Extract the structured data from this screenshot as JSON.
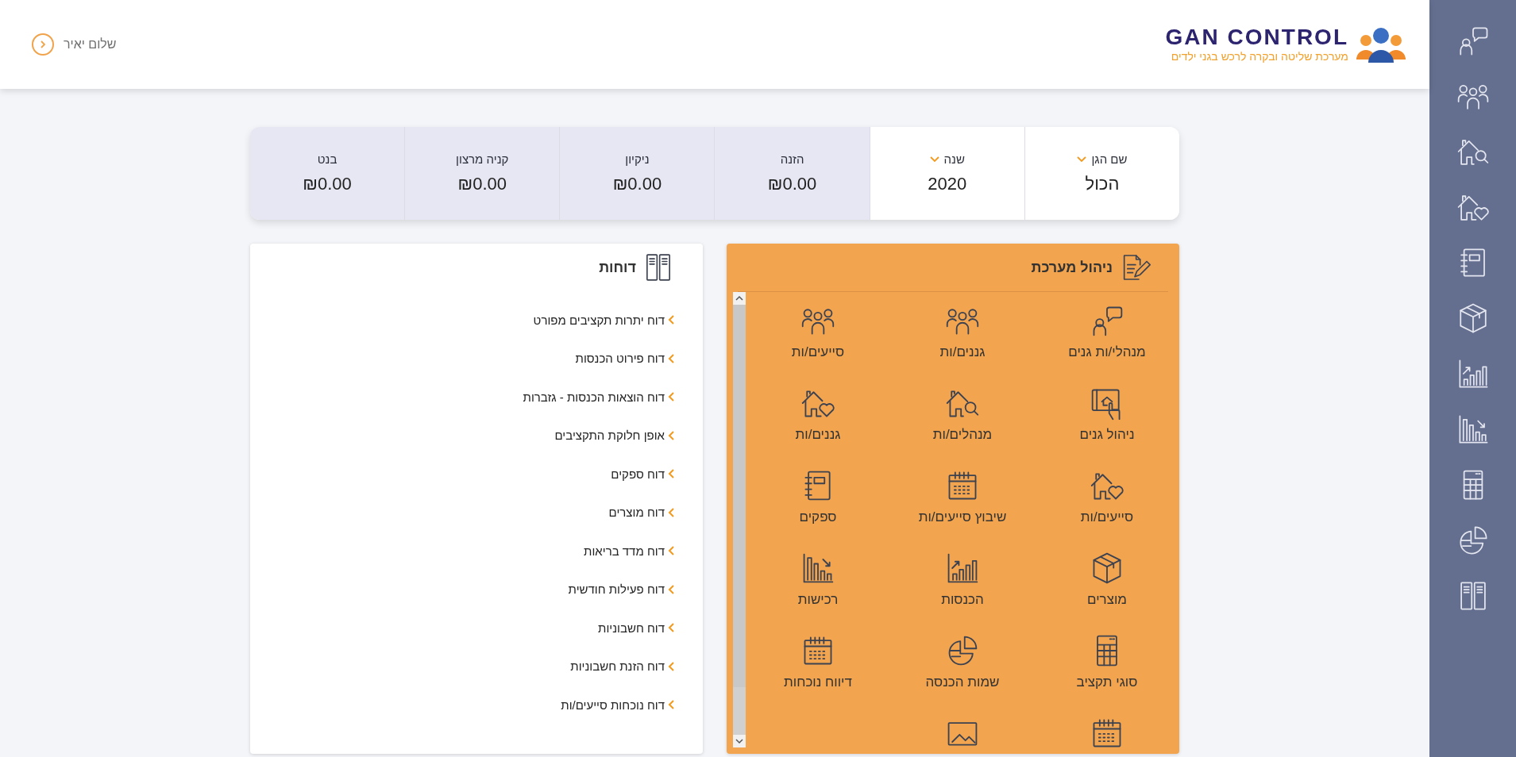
{
  "header": {
    "greeting": "שלום יאיר",
    "logo": {
      "title": "GAN CONTROL",
      "tagline": "מערכת שליטה ובקרה לרכש בגני ילדים"
    }
  },
  "summary": [
    {
      "kind": "dropdown",
      "label": "שם הגן",
      "value": "הכול"
    },
    {
      "kind": "dropdown",
      "label": "שנה",
      "value": "2020"
    },
    {
      "kind": "total",
      "label": "הזנה",
      "value": "₪0.00"
    },
    {
      "kind": "total",
      "label": "ניקיון",
      "value": "₪0.00"
    },
    {
      "kind": "total",
      "label": "קניה מרצון",
      "value": "₪0.00"
    },
    {
      "kind": "total",
      "label": "בנט",
      "value": "₪0.00"
    }
  ],
  "management": {
    "title": "ניהול מערכת",
    "items": [
      "מנהלי/ות גנים",
      "גננים/ות",
      "סייעים/ות",
      "ניהול גנים",
      "מנהלים/ות",
      "גננים/ות",
      "סייעים/ות",
      "שיבוץ סייעים/ות",
      "ספקים",
      "מוצרים",
      "הכנסות",
      "רכישות",
      "סוגי תקציב",
      "שמות הכנסה",
      "דיווח נוכחות"
    ]
  },
  "reports": {
    "title": "דוחות",
    "items": [
      "דוח יתרות תקציבים מפורט",
      "דוח פירוט הכנסות",
      "דוח הוצאות הכנסות - גזברות",
      "אופן חלוקת התקציבים",
      "דוח ספקים",
      "דוח מוצרים",
      "דוח מדד בריאות",
      "דוח פעילות חודשית",
      "דוח חשבוניות",
      "דוח הזנת חשבוניות",
      "דוח נוכחות סייעים/ות"
    ]
  }
}
